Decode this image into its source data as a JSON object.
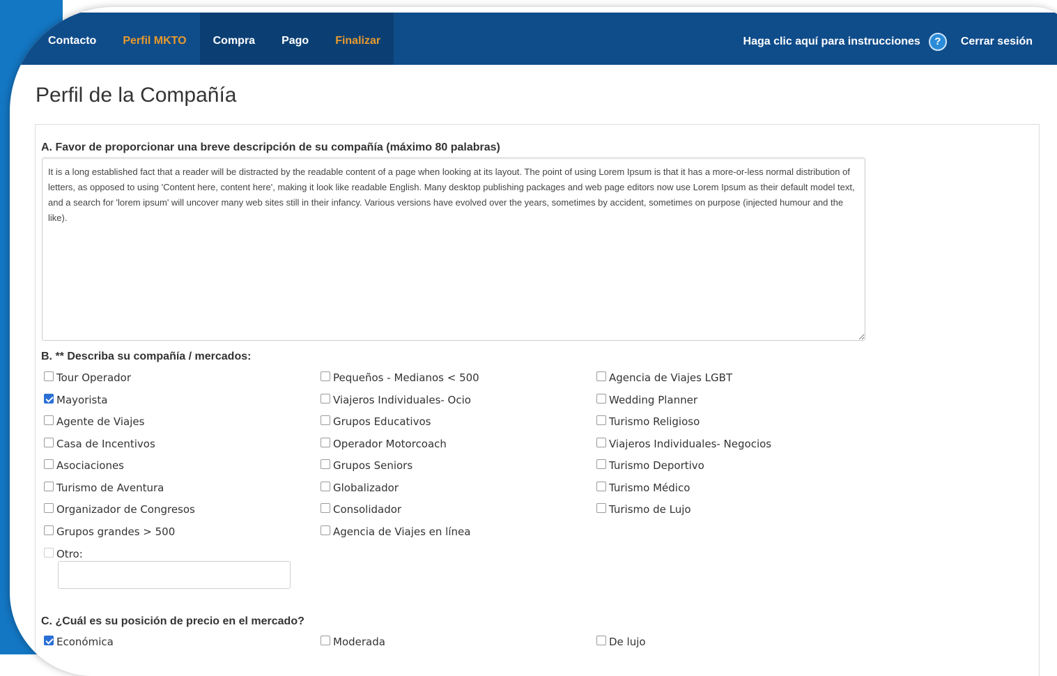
{
  "nav": {
    "items": [
      {
        "label": "Contacto",
        "style": "normal"
      },
      {
        "label": "Perfil MKTO",
        "style": "orange"
      },
      {
        "label": "Compra",
        "style": "normal"
      },
      {
        "label": "Pago",
        "style": "normal"
      },
      {
        "label": "Finalizar",
        "style": "active-orange"
      }
    ],
    "help_link": "Haga clic aquí para instrucciones",
    "help_icon": "?",
    "logout": "Cerrar sesión"
  },
  "page_title": "Perfil de la Compañía",
  "section_a": {
    "label": "A. Favor de proporcionar una breve descripción de su compañía (máximo 80 palabras)",
    "text": "It is a long established fact that a reader will be distracted by the readable content of a page when looking at its layout. The point of using Lorem Ipsum is that it has a more-or-less normal distribution of letters, as opposed to using 'Content here, content here', making it look like readable English. Many desktop publishing packages and web page editors now use Lorem Ipsum as their default model text, and a search for 'lorem ipsum' will uncover many web sites still in their infancy. Various versions have evolved over the years, sometimes by accident, sometimes on purpose (injected humour and the like)."
  },
  "section_b": {
    "label": "B. ** Describa su compañía / mercados:",
    "col1": [
      {
        "label": "Tour Operador",
        "checked": false
      },
      {
        "label": "Mayorista",
        "checked": true
      },
      {
        "label": "Agente de Viajes",
        "checked": false
      },
      {
        "label": "Casa de Incentivos",
        "checked": false
      },
      {
        "label": "Asociaciones",
        "checked": false
      },
      {
        "label": "Turismo de Aventura",
        "checked": false
      },
      {
        "label": "Organizador de Congresos",
        "checked": false
      },
      {
        "label": "Grupos grandes > 500",
        "checked": false
      },
      {
        "label": "Otro:",
        "checked": false
      }
    ],
    "col2": [
      {
        "label": "Pequeños - Medianos < 500",
        "checked": false
      },
      {
        "label": "Viajeros Individuales- Ocio",
        "checked": false
      },
      {
        "label": "Grupos Educativos",
        "checked": false
      },
      {
        "label": "Operador Motorcoach",
        "checked": false
      },
      {
        "label": "Grupos Seniors",
        "checked": false
      },
      {
        "label": "Globalizador",
        "checked": false
      },
      {
        "label": "Consolidador",
        "checked": false
      },
      {
        "label": "Agencia de Viajes en línea",
        "checked": false
      }
    ],
    "col3": [
      {
        "label": "Agencia de Viajes LGBT",
        "checked": false
      },
      {
        "label": "Wedding Planner",
        "checked": false
      },
      {
        "label": "Turismo Religioso",
        "checked": false
      },
      {
        "label": "Viajeros Individuales- Negocios",
        "checked": false
      },
      {
        "label": "Turismo Deportivo",
        "checked": false
      },
      {
        "label": "Turismo Médico",
        "checked": false
      },
      {
        "label": "Turismo de Lujo",
        "checked": false
      }
    ],
    "otro_value": ""
  },
  "section_c": {
    "label": "C. ¿Cuál es su posición de precio en el mercado?",
    "options": [
      {
        "label": "Económica",
        "checked": true
      },
      {
        "label": "Moderada",
        "checked": false
      },
      {
        "label": "De lujo",
        "checked": false
      }
    ]
  }
}
